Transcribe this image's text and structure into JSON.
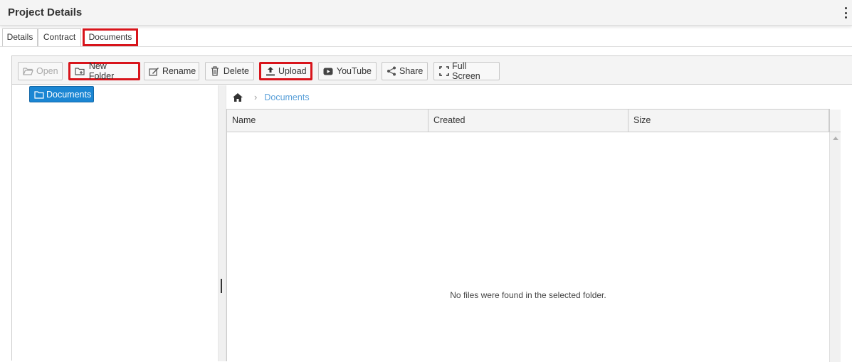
{
  "header": {
    "title": "Project Details"
  },
  "tabs": [
    {
      "label": "Details"
    },
    {
      "label": "Contract"
    },
    {
      "label": "Documents"
    }
  ],
  "toolbar": {
    "open": "Open",
    "new_folder": "New Folder",
    "rename": "Rename",
    "delete": "Delete",
    "upload": "Upload",
    "youtube": "YouTube",
    "share": "Share",
    "full_screen": "Full Screen"
  },
  "tree": {
    "root": "Documents"
  },
  "breadcrumb": {
    "current": "Documents"
  },
  "grid": {
    "columns": [
      "Name",
      "Created",
      "Size"
    ],
    "empty_message": "No files were found in the selected folder."
  },
  "colors": {
    "highlight": "#d8141b",
    "tree_selected": "#1b86d3",
    "breadcrumb_link": "#5aa0d9"
  }
}
